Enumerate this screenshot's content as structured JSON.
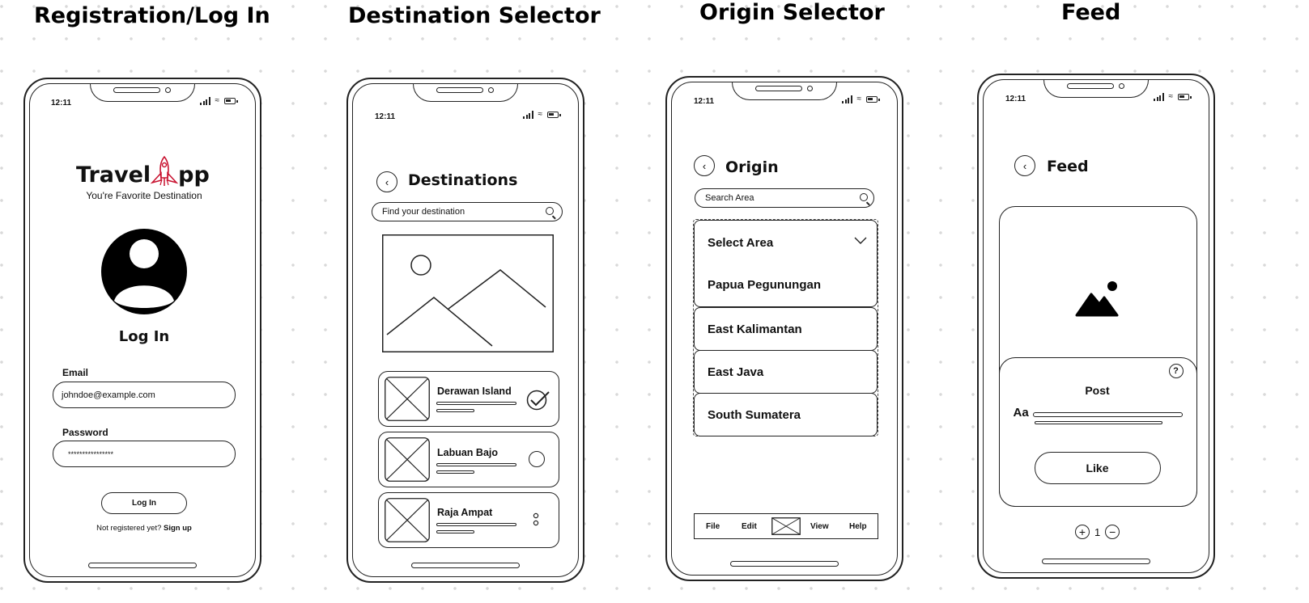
{
  "screens": [
    {
      "title": "Registration/Log In",
      "status_time": "12:11",
      "app_name_left": "Travel",
      "app_name_right": "pp",
      "tagline": "You're Favorite Destination",
      "heading": "Log In",
      "email_label": "Email",
      "email_value": "johndoe@example.com",
      "password_label": "Password",
      "password_value": "****************",
      "login_button": "Log In",
      "register_prompt": "Not registered yet?",
      "signup_link": "Sign up"
    },
    {
      "title": "Destination Selector",
      "status_time": "12:11",
      "header": "Destinations",
      "search_placeholder": "Find your destination",
      "destinations": [
        {
          "name": "Derawan Island",
          "state": "checked"
        },
        {
          "name": "Labuan Bajo",
          "state": "unchecked"
        },
        {
          "name": "Raja Ampat",
          "state": "more"
        }
      ]
    },
    {
      "title": "Origin Selector",
      "status_time": "12:11",
      "header": "Origin",
      "search_placeholder": "Search Area",
      "select_label": "Select Area",
      "areas": [
        "Papua Pegunungan",
        "East Kalimantan",
        "East Java",
        "South Sumatera"
      ],
      "menu": [
        "File",
        "Edit",
        "View",
        "Help"
      ]
    },
    {
      "title": "Feed",
      "status_time": "12:11",
      "header": "Feed",
      "post_label": "Post",
      "text_tool": "Aa",
      "like_button": "Like",
      "count": "1"
    }
  ],
  "colors": {
    "accent": "#c8102e",
    "stroke": "#222222"
  }
}
